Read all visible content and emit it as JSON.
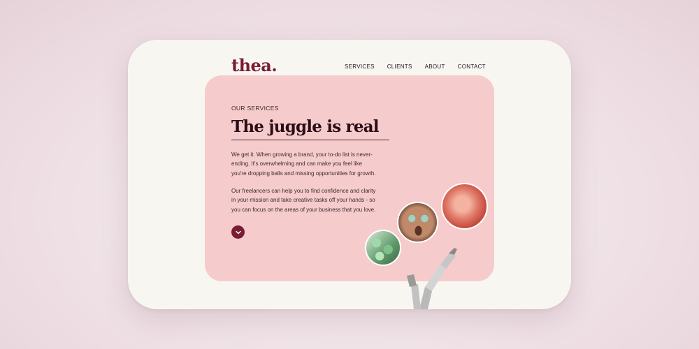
{
  "brand": {
    "logo": "thea."
  },
  "nav": {
    "items": [
      "SERVICES",
      "CLIENTS",
      "ABOUT",
      "CONTACT"
    ]
  },
  "hero": {
    "eyebrow": "OUR SERVICES",
    "headline": "The juggle is real",
    "paragraph1": "We get it. When growing a brand, your to-do list is never-ending. It's overwhelming and can make you feel like you're dropping balls and missing opportunities for growth.",
    "paragraph2": "Our freelancers can help you to find confidence and clarity in your mission and take creative tasks off your hands - so you can focus on the areas of your business that you love."
  },
  "colors": {
    "brand": "#7a1c33",
    "hero_bg": "#f6cbcc",
    "card_bg": "#f8f6f1"
  },
  "icons": {
    "scroll_button": "chevron-down-icon"
  }
}
